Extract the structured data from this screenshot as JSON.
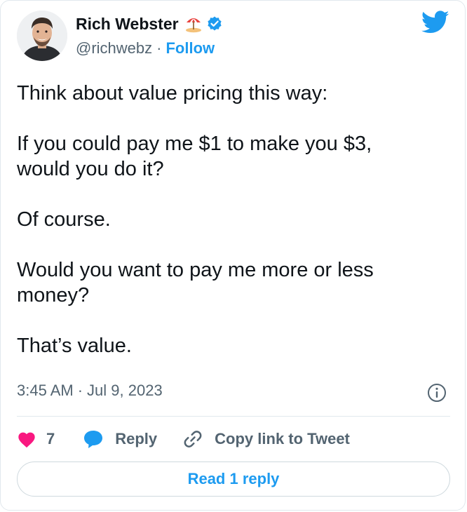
{
  "author": {
    "name": "Rich Webster",
    "handle": "@richwebz",
    "follow_label": "Follow",
    "emoji_icon": "beach-umbrella-icon",
    "verified_icon": "verified-badge-icon"
  },
  "tweet": {
    "text": "Think about value pricing this way:\n\nIf you could pay me $1 to make you $3,\nwould you do it?\n\nOf course.\n\nWould you want to pay me more or less\nmoney?\n\nThat’s value.",
    "time": "3:45 AM",
    "date": "Jul 9, 2023"
  },
  "actions": {
    "like_count": "7",
    "reply_label": "Reply",
    "copy_label": "Copy link to Tweet",
    "read_replies_label": "Read 1 reply"
  },
  "colors": {
    "accent": "#1d9bf0",
    "like": "#f91880",
    "text": "#0f1419",
    "muted": "#536471"
  }
}
